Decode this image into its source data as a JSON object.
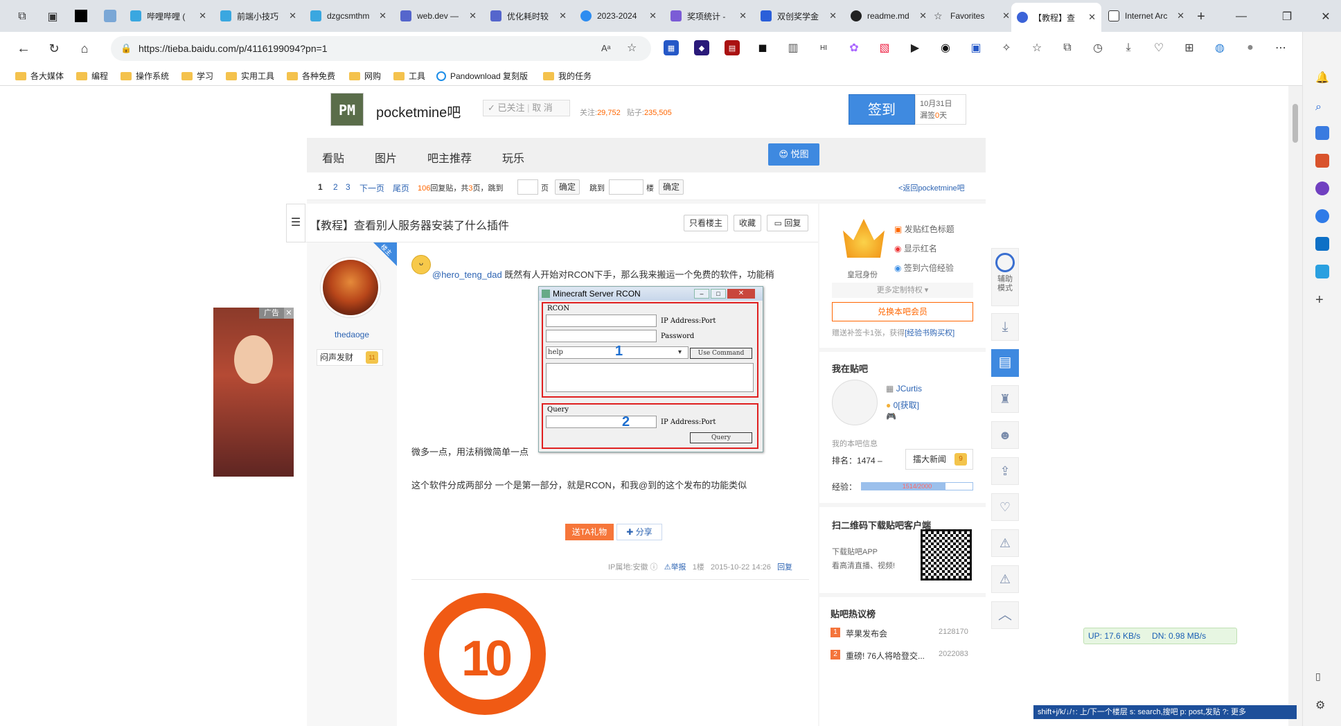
{
  "browser": {
    "tabs": [
      {
        "label": "哔哩哔哩 ("
      },
      {
        "label": "前端小技巧"
      },
      {
        "label": "dzgcsmthm"
      },
      {
        "label": "web.dev —"
      },
      {
        "label": "优化耗时较"
      },
      {
        "label": "2023-2024"
      },
      {
        "label": "奖项统计 -"
      },
      {
        "label": "双创奖学金"
      },
      {
        "label": "readme.md"
      },
      {
        "label": "Favorites"
      },
      {
        "label": "【教程】查"
      },
      {
        "label": "Internet Arc"
      }
    ],
    "url": "https://tieba.baidu.com/p/4116199094?pn=1",
    "bookmarks": [
      "各大媒体",
      "编程",
      "操作系统",
      "学习",
      "实用工具",
      "各种免费",
      "网购",
      "工具",
      "Pandownload 复刻版",
      "我的任务"
    ]
  },
  "forum": {
    "name": "pocketmine吧",
    "logo_text": "PM",
    "follow_label": "已关注",
    "cancel_label": "取 消",
    "followers_label": "关注:",
    "followers": "29,752",
    "posts_label": "贴子:",
    "posts": "235,505",
    "sign_label": "签到",
    "sign_date": "10月31日",
    "sign_missed_prefix": "漏签",
    "sign_missed": "0",
    "sign_missed_suffix": "天",
    "nav": [
      "看贴",
      "图片",
      "吧主推荐",
      "玩乐"
    ],
    "yuetu_label": "悦图"
  },
  "pager": {
    "p1": "1",
    "p2": "2",
    "p3": "3",
    "next": "下一页",
    "last": "尾页",
    "reply_count": "106",
    "reply_text": "回复贴，共",
    "pages": "3",
    "pages_suffix": "页，跳到",
    "page_unit": "页",
    "confirm": "确定",
    "jump2": "跳到",
    "floor_unit": "楼",
    "confirm2": "确定",
    "back": "<返回pocketmine吧"
  },
  "thread": {
    "title": "【教程】查看别人服务器安装了什么插件",
    "only_op": "只看楼主",
    "collect": "收藏",
    "reply": "回复"
  },
  "post": {
    "badge": "楼主",
    "author": "thedaoge",
    "author_tag": "闷声发财",
    "level": "11",
    "mention": "@hero_teng_dad",
    "text1": " 既然有人开始对RCON下手，那么我来搬运一个免费的软件，功能稍",
    "text2": "微多一点，用法稍微简单一点",
    "text3": "这个软件分成两部分 一个是第一部分，就是RCON，和我@到的这个发布的功能类似",
    "gift": "送TA礼物",
    "share": "分享",
    "ip": "IP属地:安徽",
    "report": "举报",
    "floor": "1楼",
    "time": "2015-10-22 14:26",
    "reply": "回复",
    "badge10": "10"
  },
  "rcon": {
    "title": "Minecraft Server RCON",
    "group1": "RCON",
    "ip_label": "IP Address:Port",
    "pw_label": "Password",
    "cmd_value": "help",
    "use_cmd": "Use Command",
    "num1": "1",
    "group2": "Query",
    "ip_label2": "IP Address:Port",
    "num2": "2",
    "query_btn": "Query"
  },
  "ad": {
    "label": "广告"
  },
  "side": {
    "crown_label": "皇冠身份",
    "perk1": "发贴红色标题",
    "perk2": "显示红名",
    "perk3": "签到六倍经验",
    "more": "更多定制特权",
    "exchange": "兑换本吧会员",
    "gift_text": "赠送补签卡1张，获得",
    "gift_link": "[经验书购买权]",
    "mine_title": "我在贴吧",
    "username": "JCurtis",
    "tbean": "0",
    "tbean_link": "[获取]",
    "info_label": "我的本吧信息",
    "rank_label": "排名：",
    "rank": "1474 –",
    "news": "擂大新闻",
    "news_level": "9",
    "exp_label": "经验：",
    "exp_value": "1514/2000",
    "exp_fraction": 0.757,
    "qr_title": "扫二维码下载贴吧客户端",
    "qr_text1": "下载贴吧APP",
    "qr_text2": "看高清直播、视频!",
    "hot_title": "贴吧热议榜",
    "hot": [
      {
        "rank": "1",
        "title": "苹果发布会",
        "count": "2128170"
      },
      {
        "rank": "2",
        "title": "重磅! 76人将哈登交...",
        "count": "2022083"
      }
    ]
  },
  "float": {
    "assist": "辅助模式"
  },
  "speed": {
    "up": "UP: 17.6 KB/s",
    "dn": "DN: 0.98 MB/s"
  },
  "hint": "shift+j/k/↓/↑: 上/下一个楼层  s: search,搜吧  p: post,发贴  ?: 更多"
}
